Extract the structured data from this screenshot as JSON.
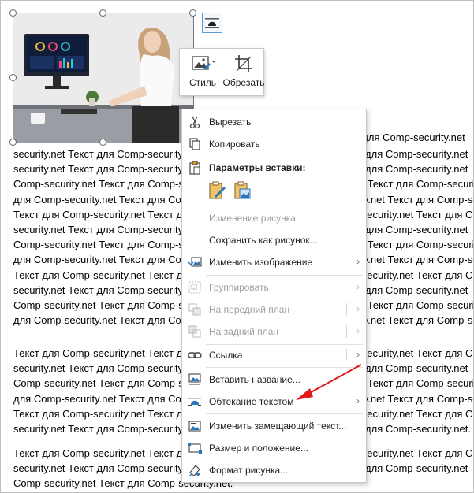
{
  "document": {
    "paragraph1": [
      "security.net Текст для Comp-security.net Текст для Comp-security.net Текст для Comp-security.net",
      "security.net Текст для Comp-security.net Текст для Comp-security.net Текст для Comp-security.net",
      "Comp-security.net Текст для Comp-security.net Текст для Comp-security.net Текст для Comp-security.net",
      "для Comp-security.net Текст для Comp-security.net Текст для Comp-security.net Текст для Comp-security",
      "Текст для Comp-security.net Текст для Comp-security.net Текст для Comp-security.net Текст для Comp-",
      "security.net Текст для Comp-security.net Текст для Comp-security.net Текст для Comp-security.net",
      "Comp-security.net Текст для Comp-security.net Текст для Comp-security.net Текст для Comp-security.net",
      "для Comp-security.net Текст для Comp-security.net Текст для Comp-security.net Текст для Comp-security",
      "Текст для Comp-security.net Текст для Comp-security.net Текст для Comp-security.net Текст для Comp-",
      "security.net Текст для Comp-security.net Текст для Comp-security.net Текст для Comp-security.net",
      "Comp-security.net Текст для Comp-security.net Текст для Comp-security.net Текст для Comp-security.net",
      "для Comp-security.net Текст для Comp-security.net Текст для Comp-security.net Текст для Comp-security.n"
    ],
    "paragraph2": [
      "Текст для Comp-security.net Текст для Comp-security.net Текст для Comp-security.net Текст для Comp-",
      "security.net Текст для Comp-security.net Текст для Comp-security.net Текст для Comp-security.net",
      "Comp-security.net Текст для Comp-security.net Текст для Comp-security.net Текст для Comp-security.net",
      "для Comp-security.net Текст для Comp-security.net Текст для Comp-security.net Текст для Comp-security",
      "Текст для Comp-security.net Текст для Comp-security.net Текст для Comp-security.net Текст для Comp-",
      "security.net Текст для Comp-security.net Текст для Comp-security.net Текст для Comp-security.net."
    ],
    "paragraph3": [
      "Текст для Comp-security.net Текст для Comp-security.net Текст для Comp-security.net Текст для Comp-",
      "security.net Текст для Comp-security.net Текст для Comp-security.net Текст для Comp-security.net",
      "Comp-security.net Текст для Comp-security.net."
    ]
  },
  "mini_toolbar": {
    "style_label": "Стиль",
    "crop_label": "Обрезать"
  },
  "context_menu": {
    "cut": "Вырезать",
    "copy": "Копировать",
    "paste_options_header": "Параметры вставки:",
    "edit_picture": "Изменение рисунка",
    "save_as_picture": "Сохранить как рисунок...",
    "change_picture": "Изменить изображение",
    "group": "Группировать",
    "bring_to_front": "На передний план",
    "send_to_back": "На задний план",
    "link": "Ссылка",
    "insert_caption": "Вставить название...",
    "wrap_text": "Обтекание текстом",
    "edit_alt_text": "Изменить замещающий текст...",
    "size_position": "Размер и положение...",
    "format_picture": "Формат рисунка..."
  },
  "colors": {
    "accent": "#2e75b6",
    "arrow": "#e11919",
    "disabled": "#9e9e9e"
  },
  "icons": {
    "cut": "scissors-icon",
    "copy": "copy-icon",
    "paste": "clipboard-icon",
    "change_picture": "change-picture-icon",
    "group": "group-icon",
    "front": "bring-front-icon",
    "back": "send-back-icon",
    "link": "link-icon",
    "caption": "caption-icon",
    "wrap": "wrap-text-icon",
    "alt_text": "alt-text-icon",
    "size": "size-position-icon",
    "format": "format-picture-icon"
  }
}
